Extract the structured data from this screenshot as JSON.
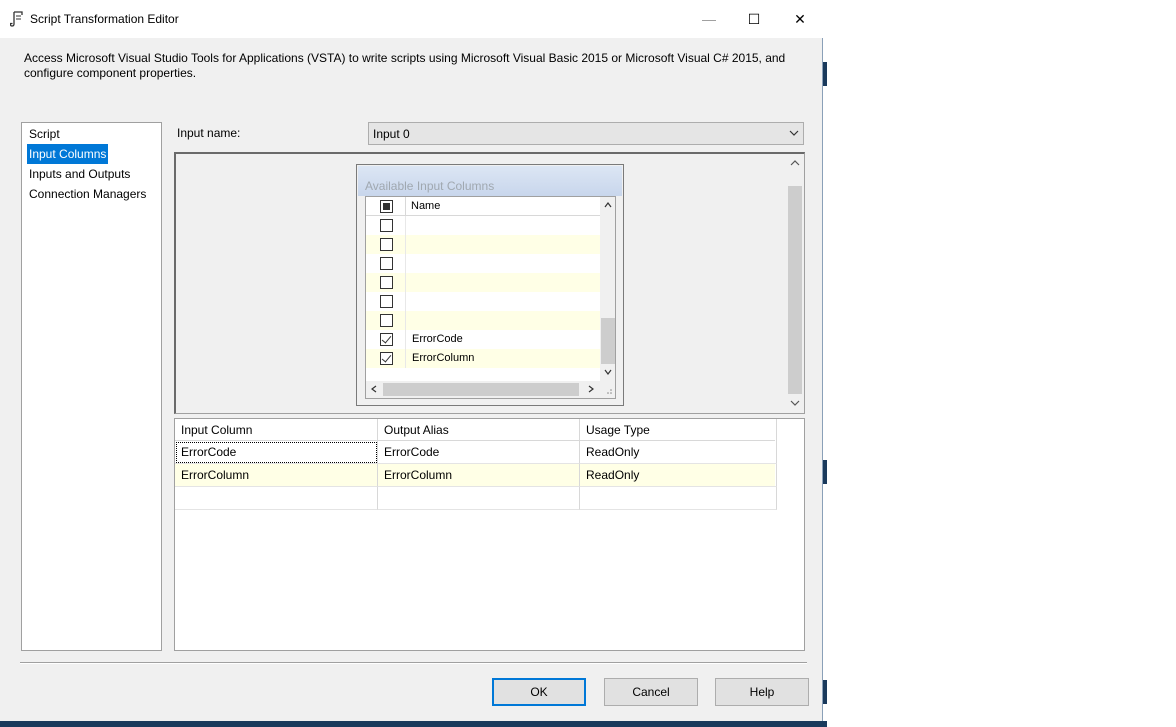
{
  "window": {
    "title": "Script Transformation Editor",
    "minimize_glyph": "—",
    "maximize_glyph": "☐",
    "close_glyph": "✕"
  },
  "description": "Access Microsoft Visual Studio Tools for Applications (VSTA) to write scripts using Microsoft Visual Basic 2015 or Microsoft Visual C# 2015, and configure component properties.",
  "nav": {
    "items": [
      {
        "label": "Script",
        "selected": false
      },
      {
        "label": "Input Columns",
        "selected": true
      },
      {
        "label": "Inputs and Outputs",
        "selected": false
      },
      {
        "label": "Connection Managers",
        "selected": false
      }
    ]
  },
  "input": {
    "label": "Input name:",
    "value": "Input 0"
  },
  "available_columns": {
    "title": "Available Input Columns",
    "header_name": "Name",
    "rows": [
      {
        "name": "",
        "checked": false
      },
      {
        "name": "",
        "checked": false
      },
      {
        "name": "",
        "checked": false
      },
      {
        "name": "",
        "checked": false
      },
      {
        "name": "",
        "checked": false
      },
      {
        "name": "",
        "checked": false
      },
      {
        "name": "ErrorCode",
        "checked": true
      },
      {
        "name": "ErrorColumn",
        "checked": true
      }
    ]
  },
  "mapping_grid": {
    "headers": [
      "Input Column",
      "Output Alias",
      "Usage Type"
    ],
    "rows": [
      [
        "ErrorCode",
        "ErrorCode",
        "ReadOnly"
      ],
      [
        "ErrorColumn",
        "ErrorColumn",
        "ReadOnly"
      ]
    ]
  },
  "buttons": {
    "ok": "OK",
    "cancel": "Cancel",
    "help": "Help"
  },
  "colors": {
    "selection": "#0078d7",
    "alt_row": "#ffffe6",
    "dialog_bg": "#f0f0f0"
  }
}
